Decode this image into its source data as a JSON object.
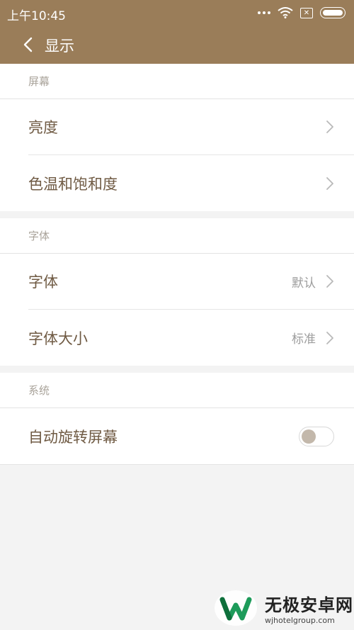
{
  "status_bar": {
    "time": "上午10:45"
  },
  "header": {
    "title": "显示"
  },
  "sections": [
    {
      "title": "屏幕",
      "rows": [
        {
          "label": "亮度",
          "value": ""
        },
        {
          "label": "色温和饱和度",
          "value": ""
        }
      ]
    },
    {
      "title": "字体",
      "rows": [
        {
          "label": "字体",
          "value": "默认"
        },
        {
          "label": "字体大小",
          "value": "标准"
        }
      ]
    },
    {
      "title": "系统",
      "rows": [
        {
          "label": "自动旋转屏幕",
          "toggle": false
        }
      ]
    }
  ],
  "watermark": {
    "title": "无极安卓网",
    "url": "wjhotelgroup.com"
  },
  "colors": {
    "header_bg": "#9a7d59",
    "label": "#6f5a43",
    "section_title": "#a9a39a"
  }
}
